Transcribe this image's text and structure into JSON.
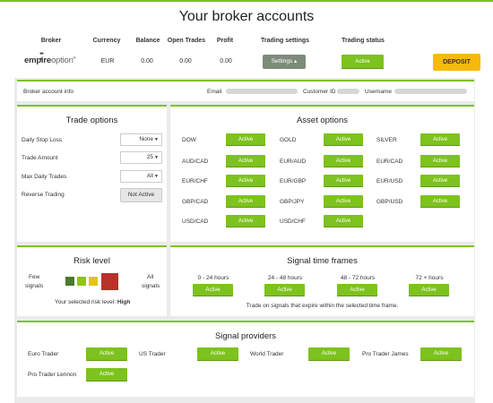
{
  "page": {
    "title": "Your broker accounts"
  },
  "table": {
    "headers": {
      "broker": "Broker",
      "currency": "Currency",
      "balance": "Balance",
      "open_trades": "Open Trades",
      "profit": "Profit",
      "trading_settings": "Trading settings",
      "trading_status": "Trading status"
    },
    "row": {
      "logo_bold": "empire",
      "logo_light": "option",
      "logo_mark": "®",
      "currency": "EUR",
      "balance": "0.00",
      "open_trades": "0.00",
      "profit": "0.00",
      "settings_label": "Settings ▴",
      "status_label": "Active",
      "deposit_label": "DEPOSIT"
    }
  },
  "account_info": {
    "label": "Broker account info",
    "email_label": "Email",
    "customer_id_label": "Customer ID",
    "username_label": "Username"
  },
  "trade_options": {
    "title": "Trade options",
    "daily_stop_loss": {
      "label": "Daily Stop Loss",
      "value": "None"
    },
    "trade_amount": {
      "label": "Trade Amount",
      "value": "25"
    },
    "max_daily_trades": {
      "label": "Max Daily Trades",
      "value": "All"
    },
    "reverse_trading": {
      "label": "Reverse Trading",
      "value": "Not Active"
    }
  },
  "asset_options": {
    "title": "Asset options",
    "assets": [
      {
        "name": "DOW",
        "status": "Active"
      },
      {
        "name": "GOLD",
        "status": "Active"
      },
      {
        "name": "SILVER",
        "status": "Active"
      },
      {
        "name": "AUD/CAD",
        "status": "Active"
      },
      {
        "name": "EUR/AUD",
        "status": "Active"
      },
      {
        "name": "EUR/CAD",
        "status": "Active"
      },
      {
        "name": "EUR/CHF",
        "status": "Active"
      },
      {
        "name": "EUR/GBP",
        "status": "Active"
      },
      {
        "name": "EUR/USD",
        "status": "Active"
      },
      {
        "name": "GBP/CAD",
        "status": "Active"
      },
      {
        "name": "GBP/JPY",
        "status": "Active"
      },
      {
        "name": "GBP/USD",
        "status": "Active"
      },
      {
        "name": "USD/CAD",
        "status": "Active"
      },
      {
        "name": "USD/CHF",
        "status": "Active"
      }
    ]
  },
  "risk_level": {
    "title": "Risk level",
    "few_line1": "Few",
    "few_line2": "signals",
    "all_line1": "All",
    "all_line2": "signals",
    "selected_label": "Your selected risk level:",
    "selected_value": "High",
    "swatch_colors": [
      "#4a7a2a",
      "#8fc31f",
      "#e6c21a",
      "#b8322a"
    ]
  },
  "signal_time_frames": {
    "title": "Signal time frames",
    "frames": [
      {
        "label": "0 - 24 hours",
        "status": "Active"
      },
      {
        "label": "24 - 48 hours",
        "status": "Active"
      },
      {
        "label": "48 - 72 hours",
        "status": "Active"
      },
      {
        "label": "72 + hours",
        "status": "Active"
      }
    ],
    "note": "Trade on signals that expire within the selected time frame."
  },
  "signal_providers": {
    "title": "Signal providers",
    "providers": [
      {
        "name": "Euro Trader",
        "status": "Active"
      },
      {
        "name": "US Trader",
        "status": "Active"
      },
      {
        "name": "World Trader",
        "status": "Active"
      },
      {
        "name": "Pro Trader James",
        "status": "Active"
      },
      {
        "name": "Pro Trader Lennon",
        "status": "Active"
      }
    ]
  },
  "colors": {
    "accent": "#7dc21e",
    "deposit": "#f7b90e",
    "settings": "#7d8c7a",
    "panel_bg": "#ebebeb"
  }
}
